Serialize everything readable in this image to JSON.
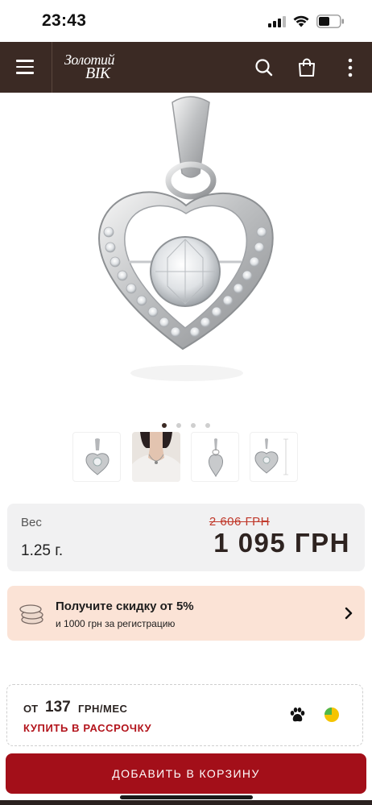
{
  "status_bar": {
    "time": "23:43"
  },
  "header": {
    "logo_line1": "Золотий",
    "logo_line2": "ВІК",
    "icons": [
      "menu-icon",
      "search-icon",
      "shopping-bag-icon",
      "more-vertical-icon"
    ]
  },
  "gallery": {
    "slide_count": 4,
    "active_slide": 1,
    "thumbnails": [
      "pendant-front-thumbnail",
      "model-wearing-thumbnail",
      "pendant-side-thumbnail",
      "pendant-dimensions-thumbnail"
    ]
  },
  "price": {
    "weight_label": "Вес",
    "weight_value": "1.25 г.",
    "old_price": "2 606 ГРН",
    "new_price": "1 095 ГРН"
  },
  "discount": {
    "title": "Получите скидку от 5%",
    "subtitle": "и 1000 грн за регистрацию"
  },
  "installment": {
    "from": "ОТ",
    "amount": "137",
    "unit": "ГРН/МЕС",
    "link": "КУПИТЬ В РАССРОЧКУ"
  },
  "cart": {
    "button_label": "ДОБАВИТЬ В КОРЗИНУ"
  },
  "colors": {
    "header": "#3b2a24",
    "accent": "#a30f19",
    "banner": "#fbe3d6",
    "card": "#f1f1f2"
  }
}
